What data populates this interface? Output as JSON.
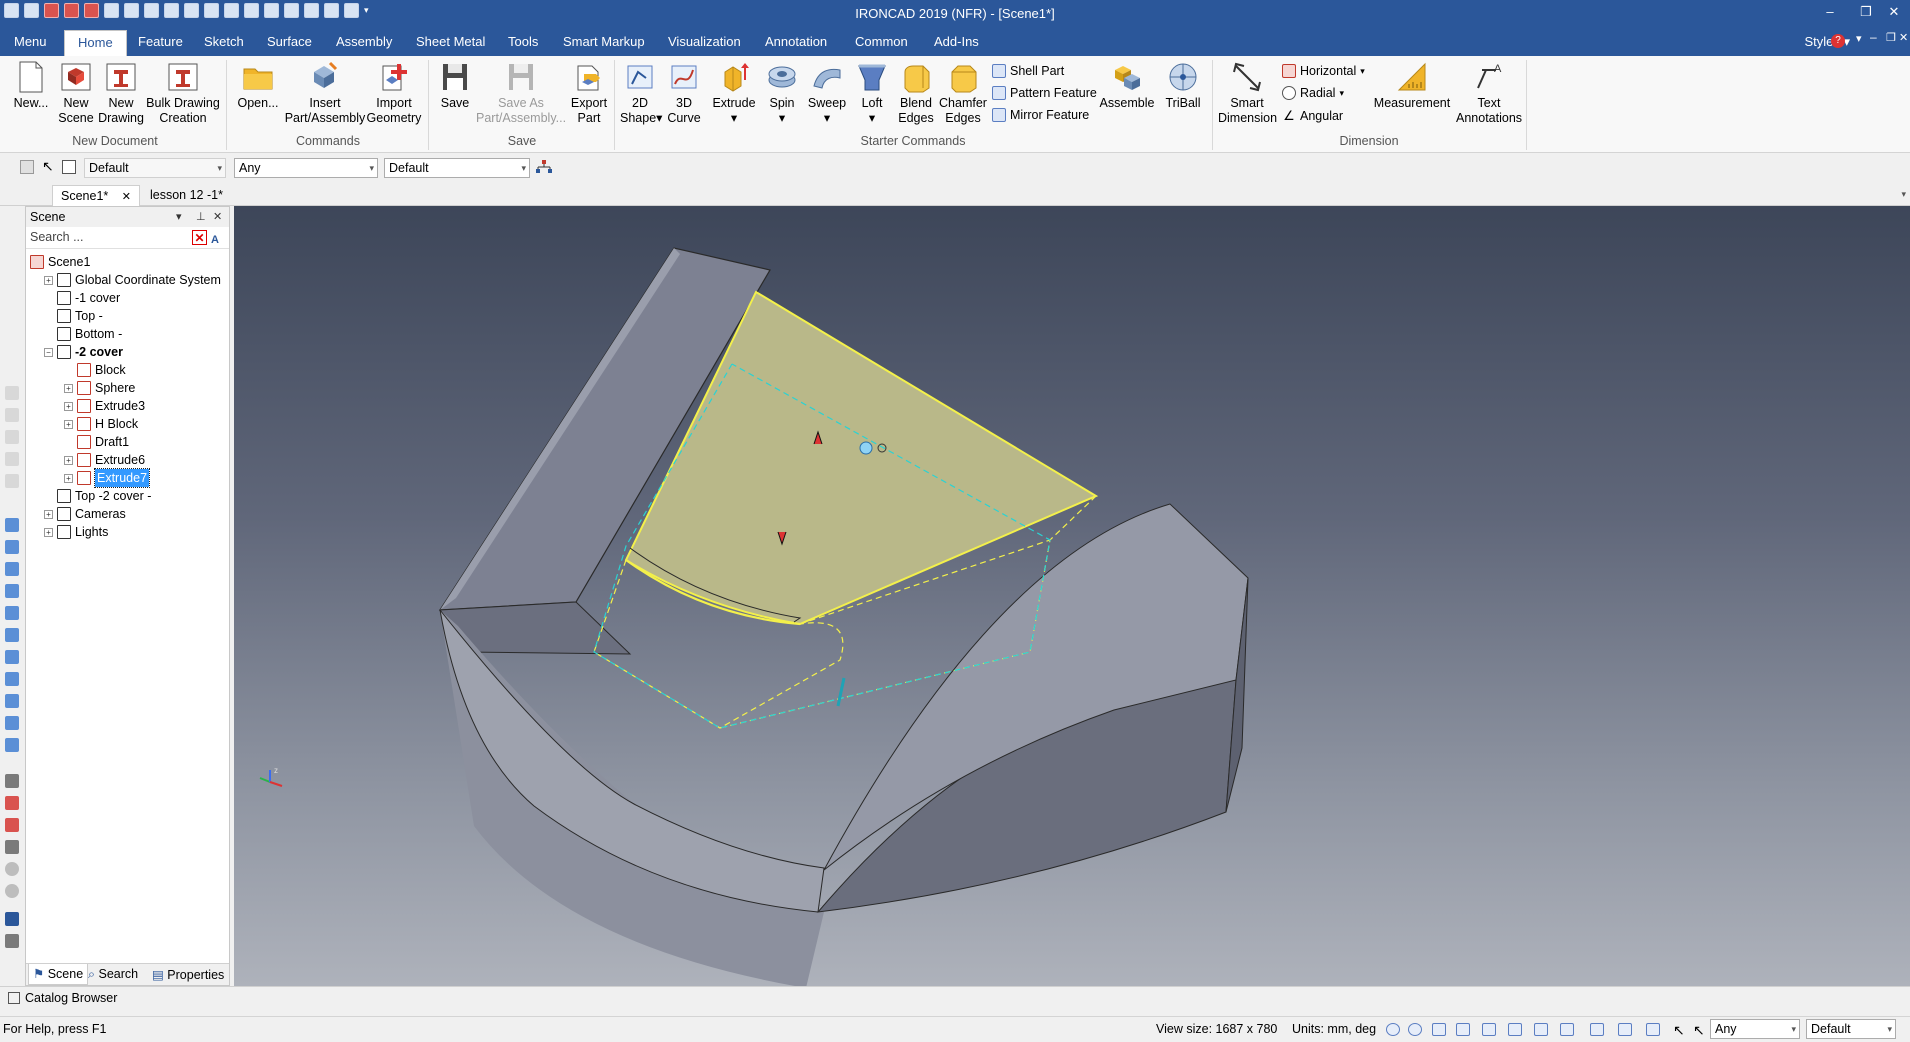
{
  "window": {
    "title": "IRONCAD 2019 (NFR) - [Scene1*]"
  },
  "menu": {
    "items": [
      "Menu",
      "Home",
      "Feature",
      "Sketch",
      "Surface",
      "Assembly",
      "Sheet Metal",
      "Tools",
      "Smart Markup",
      "Visualization",
      "Annotation",
      "Common",
      "Add-Ins"
    ],
    "active": "Home",
    "styles_label": "Styles"
  },
  "ribbon": {
    "new_document": {
      "label": "New Document",
      "new": "New...",
      "new_scene": [
        "New",
        "Scene"
      ],
      "new_drawing": [
        "New",
        "Drawing"
      ],
      "bulk": [
        "Bulk Drawing",
        "Creation"
      ]
    },
    "commands": {
      "label": "Commands",
      "open": "Open...",
      "insert": [
        "Insert",
        "Part/Assembly"
      ],
      "import": [
        "Import",
        "Geometry"
      ]
    },
    "save": {
      "label": "Save",
      "save": "Save",
      "save_as": [
        "Save As",
        "Part/Assembly..."
      ],
      "export": [
        "Export",
        "Part"
      ]
    },
    "starter": {
      "label": "Starter Commands",
      "shape2d": [
        "2D",
        "Shape"
      ],
      "curve3d": [
        "3D",
        "Curve"
      ],
      "extrude": "Extrude",
      "spin": "Spin",
      "sweep": "Sweep",
      "loft": "Loft",
      "blend": [
        "Blend",
        "Edges"
      ],
      "chamfer": [
        "Chamfer",
        "Edges"
      ],
      "shell": "Shell Part",
      "pattern": "Pattern Feature",
      "mirror": "Mirror Feature",
      "assemble": "Assemble",
      "triball": "TriBall"
    },
    "dimension": {
      "label": "Dimension",
      "smart": [
        "Smart",
        "Dimension"
      ],
      "horizontal": "Horizontal",
      "radial": "Radial",
      "angular": "Angular",
      "measurement": "Measurement",
      "text": [
        "Text",
        "Annotations"
      ]
    }
  },
  "toolbar": {
    "style_value": "Default",
    "filter_value": "Any",
    "material_value": "Default"
  },
  "doc_tabs": [
    "Scene1*",
    "lesson 12 -1*"
  ],
  "scene_panel": {
    "title": "Scene",
    "search_placeholder": "Search ...",
    "tree": [
      {
        "label": "Scene1",
        "level": 0,
        "expander": "",
        "bold": false,
        "selected": false
      },
      {
        "label": "Global Coordinate System",
        "level": 1,
        "expander": "+",
        "bold": false,
        "selected": false
      },
      {
        "label": "-1 cover",
        "level": 1,
        "expander": "",
        "bold": false,
        "selected": false
      },
      {
        "label": "Top -",
        "level": 1,
        "expander": "",
        "bold": false,
        "selected": false
      },
      {
        "label": "Bottom  -",
        "level": 1,
        "expander": "",
        "bold": false,
        "selected": false
      },
      {
        "label": "-2 cover",
        "level": 1,
        "expander": "−",
        "bold": true,
        "selected": false
      },
      {
        "label": "Block",
        "level": 2,
        "expander": "",
        "bold": false,
        "selected": false
      },
      {
        "label": "Sphere",
        "level": 2,
        "expander": "+",
        "bold": false,
        "selected": false
      },
      {
        "label": "Extrude3",
        "level": 2,
        "expander": "+",
        "bold": false,
        "selected": false
      },
      {
        "label": "H Block",
        "level": 2,
        "expander": "+",
        "bold": false,
        "selected": false
      },
      {
        "label": "Draft1",
        "level": 2,
        "expander": "",
        "bold": false,
        "selected": false
      },
      {
        "label": "Extrude6",
        "level": 2,
        "expander": "+",
        "bold": false,
        "selected": false
      },
      {
        "label": "Extrude7",
        "level": 2,
        "expander": "+",
        "bold": false,
        "selected": true
      },
      {
        "label": "Top -2 cover -",
        "level": 1,
        "expander": "",
        "bold": false,
        "selected": false
      },
      {
        "label": "Cameras",
        "level": 1,
        "expander": "+",
        "bold": false,
        "selected": false
      },
      {
        "label": "Lights",
        "level": 1,
        "expander": "+",
        "bold": false,
        "selected": false
      }
    ],
    "tabs": [
      "Scene",
      "Search",
      "Properties"
    ]
  },
  "catalog_label": "Catalog Browser",
  "status": {
    "help": "For Help, press F1",
    "view_size": "View size: 1687 x  780",
    "units": "Units: mm, deg",
    "filter_value": "Any",
    "style_value": "Default"
  }
}
